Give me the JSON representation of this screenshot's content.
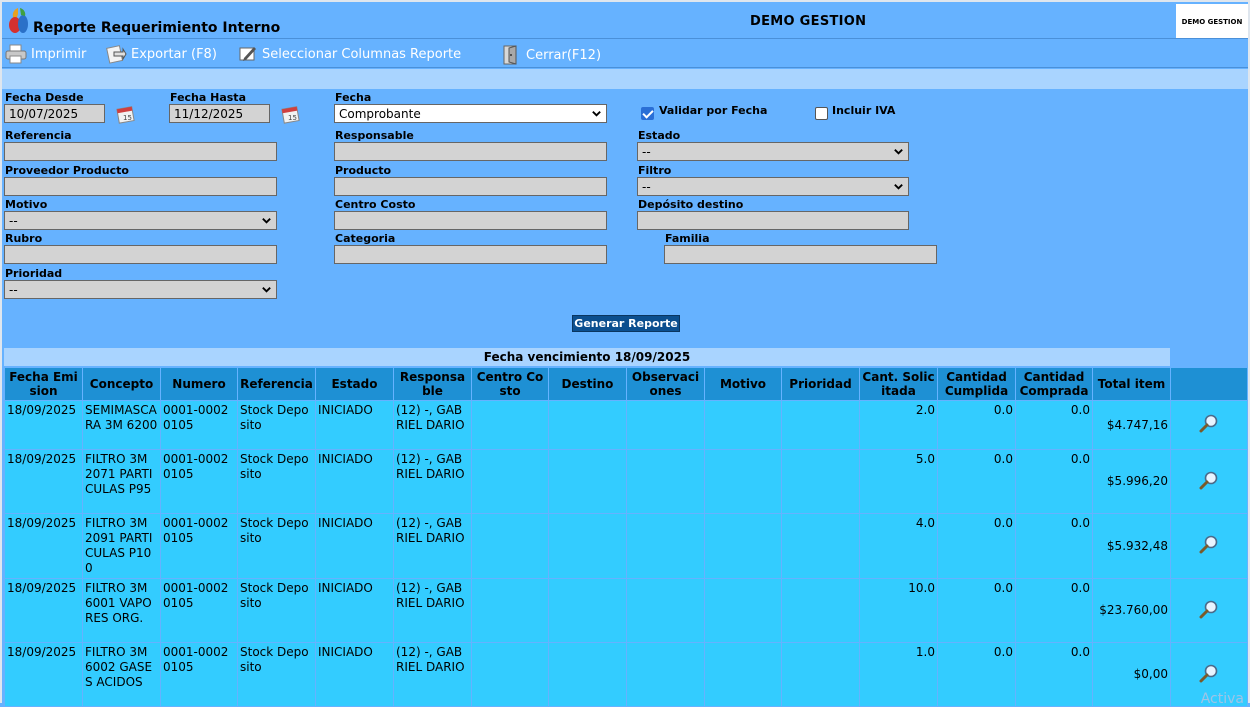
{
  "header": {
    "title": "Reporte Requerimiento Interno",
    "company": "DEMO GESTION",
    "brand_box": "DEMO GESTION"
  },
  "toolbar": {
    "print_label": "Imprimir",
    "export_label": "Exportar (F8)",
    "columns_label": "Seleccionar Columnas Reporte",
    "close_label": "Cerrar(F12)"
  },
  "filters": {
    "fecha_desde": {
      "label": "Fecha Desde",
      "value": "10/07/2025"
    },
    "fecha_hasta": {
      "label": "Fecha Hasta",
      "value": "11/12/2025"
    },
    "fecha": {
      "label": "Fecha",
      "value": "Comprobante"
    },
    "validar": {
      "label": "Validar por Fecha",
      "checked": true
    },
    "incluir_iva": {
      "label": "Incluir IVA",
      "checked": false
    },
    "referencia": {
      "label": "Referencia",
      "value": ""
    },
    "responsable": {
      "label": "Responsable",
      "value": ""
    },
    "estado": {
      "label": "Estado",
      "value": "--"
    },
    "proveedor_producto": {
      "label": "Proveedor Producto",
      "value": ""
    },
    "producto": {
      "label": "Producto",
      "value": ""
    },
    "filtro": {
      "label": "Filtro",
      "value": "--"
    },
    "motivo": {
      "label": "Motivo",
      "value": "--"
    },
    "centro_costo": {
      "label": "Centro Costo",
      "value": ""
    },
    "deposito_destino": {
      "label": "Depósito destino",
      "value": ""
    },
    "rubro": {
      "label": "Rubro",
      "value": ""
    },
    "categoria": {
      "label": "Categoria",
      "value": ""
    },
    "familia": {
      "label": "Familia",
      "value": ""
    },
    "prioridad": {
      "label": "Prioridad",
      "value": "--"
    }
  },
  "generate_label": "Generar Reporte",
  "group_header": "Fecha vencimiento 18/09/2025",
  "table": {
    "columns": [
      "Fecha Emision",
      "Concepto",
      "Numero",
      "Referencia",
      "Estado",
      "Responsable",
      "Centro Costo",
      "Destino",
      "Observaciones",
      "Motivo",
      "Prioridad",
      "Cant. Solicitada",
      "Cantidad Cumplida",
      "Cantidad Comprada",
      "Total item",
      ""
    ],
    "rows": [
      {
        "fecha": "18/09/2025",
        "concepto": "SEMIMASCARA 3M 6200",
        "numero": "0001-00020105",
        "referencia": "Stock Deposito",
        "estado": "INICIADO",
        "responsable": "(12) -, GABRIEL DARIO",
        "centro_costo": "",
        "destino": "",
        "observaciones": "",
        "motivo": "",
        "prioridad": "",
        "solicitada": "2.0",
        "cumplida": "0.0",
        "comprada": "0.0",
        "total": "$4.747,16"
      },
      {
        "fecha": "18/09/2025",
        "concepto": "FILTRO 3M 2071 PARTICULAS P95",
        "numero": "0001-00020105",
        "referencia": "Stock Deposito",
        "estado": "INICIADO",
        "responsable": "(12) -, GABRIEL DARIO",
        "centro_costo": "",
        "destino": "",
        "observaciones": "",
        "motivo": "",
        "prioridad": "",
        "solicitada": "5.0",
        "cumplida": "0.0",
        "comprada": "0.0",
        "total": "$5.996,20"
      },
      {
        "fecha": "18/09/2025",
        "concepto": "FILTRO 3M 2091 PARTICULAS P100",
        "numero": "0001-00020105",
        "referencia": "Stock Deposito",
        "estado": "INICIADO",
        "responsable": "(12) -, GABRIEL DARIO",
        "centro_costo": "",
        "destino": "",
        "observaciones": "",
        "motivo": "",
        "prioridad": "",
        "solicitada": "4.0",
        "cumplida": "0.0",
        "comprada": "0.0",
        "total": "$5.932,48"
      },
      {
        "fecha": "18/09/2025",
        "concepto": "FILTRO 3M 6001 VAPORES ORG.",
        "numero": "0001-00020105",
        "referencia": "Stock Deposito",
        "estado": "INICIADO",
        "responsable": "(12) -, GABRIEL DARIO",
        "centro_costo": "",
        "destino": "",
        "observaciones": "",
        "motivo": "",
        "prioridad": "",
        "solicitada": "10.0",
        "cumplida": "0.0",
        "comprada": "0.0",
        "total": "$23.760,00"
      },
      {
        "fecha": "18/09/2025",
        "concepto": "FILTRO 3M 6002 GASES ACIDOS",
        "numero": "0001-00020105",
        "referencia": "Stock Deposito",
        "estado": "INICIADO",
        "responsable": "(12) -, GABRIEL DARIO",
        "centro_costo": "",
        "destino": "",
        "observaciones": "",
        "motivo": "",
        "prioridad": "",
        "solicitada": "1.0",
        "cumplida": "0.0",
        "comprada": "0.0",
        "total": "$0,00"
      }
    ]
  },
  "watermark": "Activa",
  "icons": {
    "app": "app-logo-icon",
    "print": "printer-icon",
    "export": "export-icon",
    "columns": "columns-icon",
    "close": "close-door-icon",
    "calendar": "calendar-icon",
    "detail": "magnifier-icon"
  },
  "colors": {
    "background": "#66b2ff",
    "header": "#1e90d4",
    "row": "#33ccff",
    "strip": "#a9d4ff",
    "button": "#0b4f8f"
  }
}
